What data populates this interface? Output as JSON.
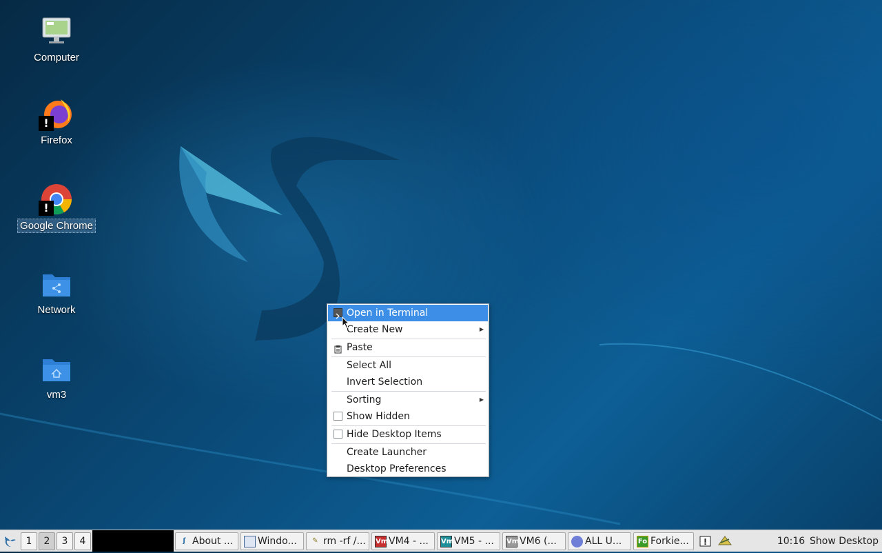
{
  "desktop": {
    "icons": [
      {
        "label": "Computer",
        "icon": "computer-icon"
      },
      {
        "label": "Firefox",
        "icon": "firefox-icon"
      },
      {
        "label": "Google Chrome",
        "icon": "chrome-icon"
      },
      {
        "label": "Network",
        "icon": "network-folder-icon"
      },
      {
        "label": "vm3",
        "icon": "home-folder-icon"
      }
    ]
  },
  "context_menu": {
    "items": [
      {
        "label": "Open in Terminal",
        "icon": "terminal-icon",
        "active": true
      },
      {
        "label": "Create New",
        "submenu": true
      },
      {
        "label": "Paste",
        "icon": "paste-icon"
      },
      {
        "label": "Select All"
      },
      {
        "label": "Invert Selection"
      },
      {
        "label": "Sorting",
        "submenu": true
      },
      {
        "label": "Show Hidden",
        "checkbox": true,
        "checked": false
      },
      {
        "label": "Hide Desktop Items",
        "checkbox": true,
        "checked": false
      },
      {
        "label": "Create Launcher"
      },
      {
        "label": "Desktop Preferences"
      }
    ]
  },
  "taskbar": {
    "start_icon": "start-menu-icon",
    "workspaces": [
      "1",
      "2",
      "3",
      "4"
    ],
    "current_workspace": "2",
    "tasks": [
      {
        "label": "About ...",
        "icon": "about-icon"
      },
      {
        "label": "Windo...",
        "icon": "window-icon"
      },
      {
        "label": "rm -rf /...",
        "icon": "terminal-icon"
      },
      {
        "label": "VM4 - ...",
        "icon": "vm-icon",
        "badge": "Vm"
      },
      {
        "label": "VM5 - ...",
        "icon": "vm-icon",
        "badge": "Vm"
      },
      {
        "label": "VM6 (...",
        "icon": "vm-icon",
        "badge": "Vm"
      },
      {
        "label": "ALL U...",
        "icon": "network-icon"
      },
      {
        "label": "Forkie...",
        "icon": "fo-icon",
        "badge": "Fo"
      }
    ],
    "clock": "10:16",
    "show_desktop": "Show Desktop"
  },
  "colors": {
    "menu_highlight": "#3d8ee6",
    "taskbar_bg": "#e6e6e6"
  }
}
